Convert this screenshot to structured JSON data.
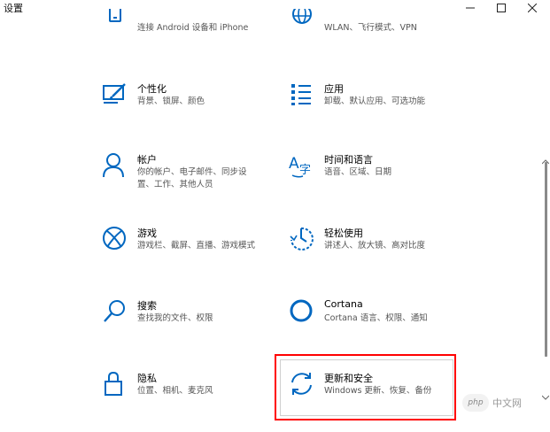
{
  "window": {
    "title": "设置",
    "minimize_glyph": "—",
    "maximize_glyph": "☐",
    "close_glyph": "✕"
  },
  "accent_color": "#0067c0",
  "highlight_color": "#ff0000",
  "tiles": [
    {
      "id": "phone",
      "name": "",
      "desc": "连接 Android 设备和 iPhone",
      "icon": "phone-icon"
    },
    {
      "id": "network",
      "name": "",
      "desc": "WLAN、飞行模式、VPN",
      "icon": "globe-icon"
    },
    {
      "id": "personalization",
      "name": "个性化",
      "desc": "背景、锁屏、颜色",
      "icon": "paintbrush-icon"
    },
    {
      "id": "apps",
      "name": "应用",
      "desc": "卸载、默认应用、可选功能",
      "icon": "apps-list-icon"
    },
    {
      "id": "accounts",
      "name": "帐户",
      "desc": "你的帐户、电子邮件、同步设置、工作、其他人员",
      "icon": "person-icon"
    },
    {
      "id": "time",
      "name": "时间和语言",
      "desc": "语音、区域、日期",
      "icon": "time-language-icon"
    },
    {
      "id": "gaming",
      "name": "游戏",
      "desc": "游戏栏、截屏、直播、游戏模式",
      "icon": "xbox-icon"
    },
    {
      "id": "ease",
      "name": "轻松使用",
      "desc": "讲述人、放大镜、高对比度",
      "icon": "ease-of-access-icon"
    },
    {
      "id": "search",
      "name": "搜索",
      "desc": "查找我的文件、权限",
      "icon": "search-icon"
    },
    {
      "id": "cortana",
      "name": "Cortana",
      "desc": "Cortana 语言、权限、通知",
      "icon": "cortana-icon"
    },
    {
      "id": "privacy",
      "name": "隐私",
      "desc": "位置、相机、麦克风",
      "icon": "lock-icon"
    },
    {
      "id": "update",
      "name": "更新和安全",
      "desc": "Windows 更新、恢复、备份",
      "icon": "sync-icon"
    }
  ],
  "watermark": {
    "badge": "php",
    "text": "中文网"
  }
}
